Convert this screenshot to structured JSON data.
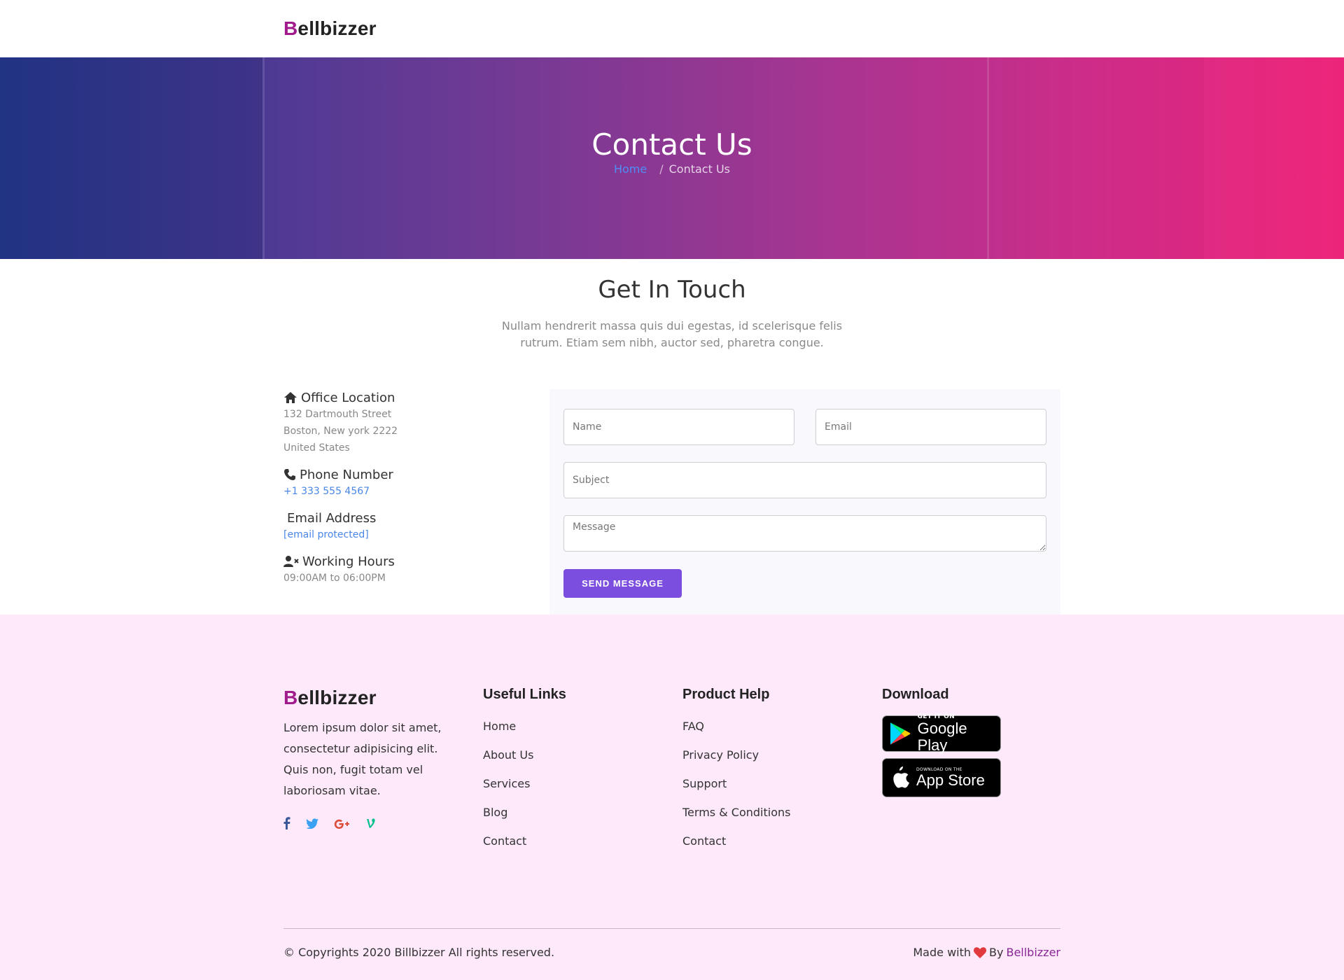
{
  "header": {
    "logo_first": "B",
    "logo_rest": "ellbizzer"
  },
  "hero": {
    "title": "Contact Us",
    "breadcrumb_home": "Home",
    "breadcrumb_separator": "/",
    "breadcrumb_current": "Contact Us"
  },
  "touch": {
    "title": "Get In Touch",
    "subtitle": "Nullam hendrerit massa quis dui egestas, id scelerisque felis rutrum. Etiam sem nibh, auctor sed, pharetra congue."
  },
  "contact_info": {
    "office_label": "Office Location",
    "office_lines": [
      "132 Dartmouth Street",
      "Boston, New york 2222",
      "United States"
    ],
    "phone_label": "Phone Number",
    "phone_value": "+1 333 555 4567",
    "email_label": "Email Address",
    "email_value": "[email protected]",
    "hours_label": "Working Hours",
    "hours_value": "09:00AM to 06:00PM"
  },
  "form": {
    "name_placeholder": "Name",
    "email_placeholder": "Email",
    "subject_placeholder": "Subject",
    "message_placeholder": "Message",
    "send_label": "SEND MESSAGE"
  },
  "footer": {
    "about_text": "Lorem ipsum dolor sit amet, consectetur adipisicing elit. Quis non, fugit totam vel laboriosam vitae.",
    "useful_links_title": "Useful Links",
    "useful_links": [
      "Home",
      "About Us",
      "Services",
      "Blog",
      "Contact"
    ],
    "product_help_title": "Product Help",
    "product_help": [
      "FAQ",
      "Privacy Policy",
      "Support",
      "Terms & Conditions",
      "Contact"
    ],
    "download_title": "Download",
    "google_play_small": "GET IT ON",
    "google_play_big": "Google Play",
    "app_store_small": "DOWNLOAD ON THE",
    "app_store_big": "App Store",
    "socials": [
      "facebook-icon",
      "twitter-icon",
      "google-plus-icon",
      "vine-icon"
    ],
    "copyright": "© Copyrights 2020 Billbizzer All rights reserved.",
    "made_with": "Made with",
    "by": "By",
    "brand": "Bellbizzer"
  },
  "colors": {
    "brand_b": "#a01a8c",
    "button": "#7b4ee0",
    "footer_bg": "#fee9fb",
    "link": "#4a86e8",
    "heart": "#e0393e"
  }
}
